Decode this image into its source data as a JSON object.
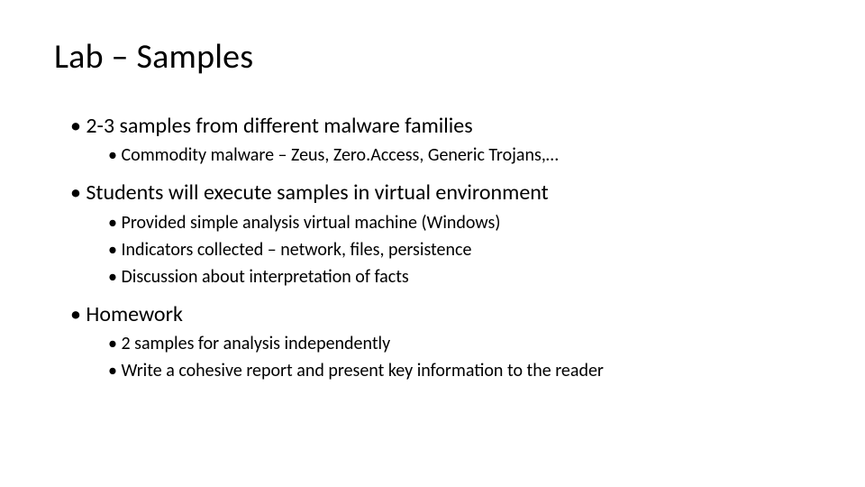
{
  "title": "Lab – Samples",
  "bullets": {
    "b1": "2-3 samples from different malware families",
    "b1a": "Commodity malware – Zeus, Zero.Access, Generic Trojans,…",
    "b2": "Students will execute samples in virtual environment",
    "b2a": "Provided simple analysis virtual machine (Windows)",
    "b2b": "Indicators collected – network, files, persistence",
    "b2c": "Discussion about interpretation of facts",
    "b3": "Homework",
    "b3a": "2 samples for analysis independently",
    "b3b": "Write a cohesive report and present key information to the reader"
  }
}
